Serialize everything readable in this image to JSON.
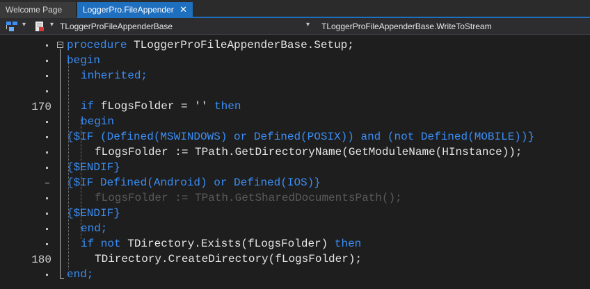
{
  "tabs": [
    {
      "label": "Welcome Page"
    },
    {
      "label": "LoggerPro.FileAppender",
      "close": "✕"
    }
  ],
  "toolbar": {
    "class_selector": "TLoggerProFileAppenderBase",
    "method_selector": "TLoggerProFileAppenderBase.WriteToStream"
  },
  "gutter": {
    "line_numbers": [
      "170",
      "180"
    ]
  },
  "code": {
    "l1_kw": "procedure",
    "l1_tx": " TLoggerProFileAppenderBase.Setup;",
    "l2": "begin",
    "l3": "inherited;",
    "l5_if": "if",
    "l5_mid": " fLogsFolder = '' ",
    "l5_then": "then",
    "l6": "begin",
    "l7": "{$IF (Defined(MSWINDOWS) or Defined(POSIX)) and (not Defined(MOBILE))}",
    "l8": "fLogsFolder := TPath.GetDirectoryName(GetModuleName(HInstance));",
    "l9": "{$ENDIF}",
    "l10": "{$IF Defined(Android) or Defined(IOS)}",
    "l11": "fLogsFolder := TPath.GetSharedDocumentsPath();",
    "l12": "{$ENDIF}",
    "l13": "end;",
    "l14_kw1": "if not",
    "l14_mid": " TDirectory.Exists(fLogsFolder) ",
    "l14_kw2": "then",
    "l15": "TDirectory.CreateDirectory(fLogsFolder);",
    "l16": "end;"
  }
}
